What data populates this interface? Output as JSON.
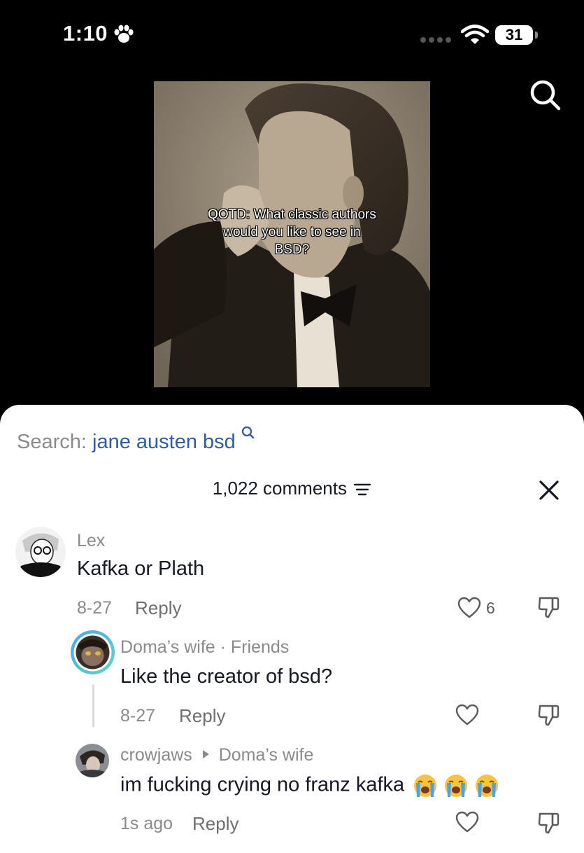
{
  "status": {
    "time": "1:10",
    "battery": "31"
  },
  "video": {
    "caption_lines": [
      "QOTD: What classic authors",
      "would you like to see in",
      "BSD?"
    ]
  },
  "search": {
    "label": "Search:",
    "query": "jane austen bsd"
  },
  "comments_header": {
    "count_label": "1,022 comments"
  },
  "comments": [
    {
      "user": "Lex",
      "text": "Kafka or Plath",
      "date": "8-27",
      "reply": "Reply",
      "likes": "6"
    },
    {
      "user": "Doma’s wife",
      "tag": "· Friends",
      "text": "Like the creator of bsd?",
      "date": "8-27",
      "reply": "Reply"
    },
    {
      "user": "crowjaws",
      "reply_to": "Doma’s wife",
      "text": "im fucking crying no franz kafka",
      "date": "1s ago",
      "reply": "Reply",
      "emojis": [
        "loudly-crying-face",
        "loudly-crying-face",
        "loudly-crying-face"
      ]
    }
  ],
  "icons": [
    "paw-icon",
    "signal-icon",
    "wifi-icon",
    "search-icon",
    "filter-icon",
    "close-icon",
    "search-small-icon",
    "heart-icon",
    "dislike-icon",
    "reply-arrow-icon"
  ]
}
